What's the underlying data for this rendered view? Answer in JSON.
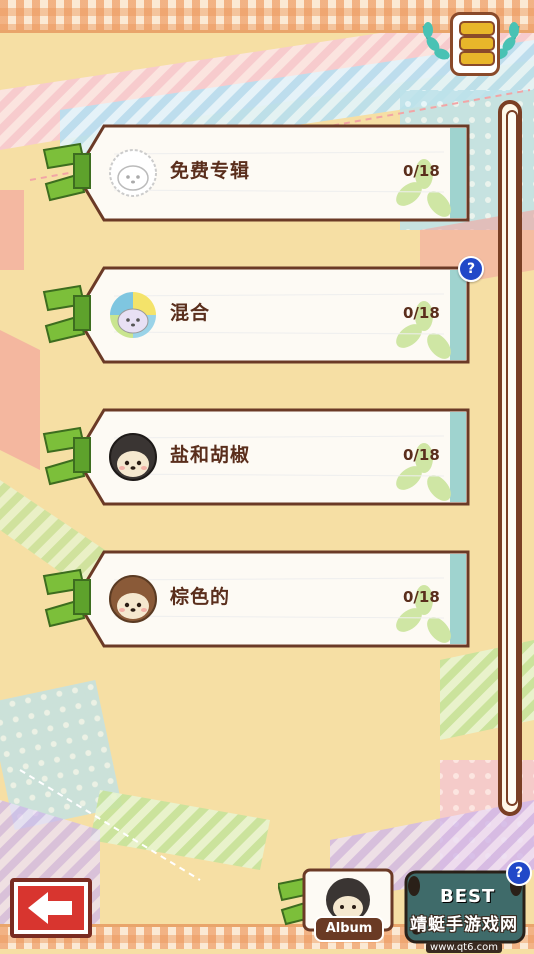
{
  "rows": [
    {
      "label": "免费专辑",
      "count": "0/18",
      "avatar": "outline-hedgehog",
      "help": false
    },
    {
      "label": "混合",
      "count": "0/18",
      "avatar": "rainbow-hedgehog",
      "help": true
    },
    {
      "label": "盐和胡椒",
      "count": "0/18",
      "avatar": "dark-hedgehog",
      "help": false
    },
    {
      "label": "棕色的",
      "count": "0/18",
      "avatar": "brown-hedgehog",
      "help": false
    }
  ],
  "help_symbol": "?",
  "bottom": {
    "album_label": "Album",
    "best_label": "BEST",
    "best_help": "?"
  },
  "watermark": {
    "title": "靖蜓手游戏网",
    "url": "www.qt6.com"
  },
  "colors": {
    "card_border": "#6b3a26",
    "label": "#5a2e1c",
    "accent_blue": "#2148c8",
    "back_red": "#d8352f",
    "ribbon_green": "#7cbf3a"
  }
}
